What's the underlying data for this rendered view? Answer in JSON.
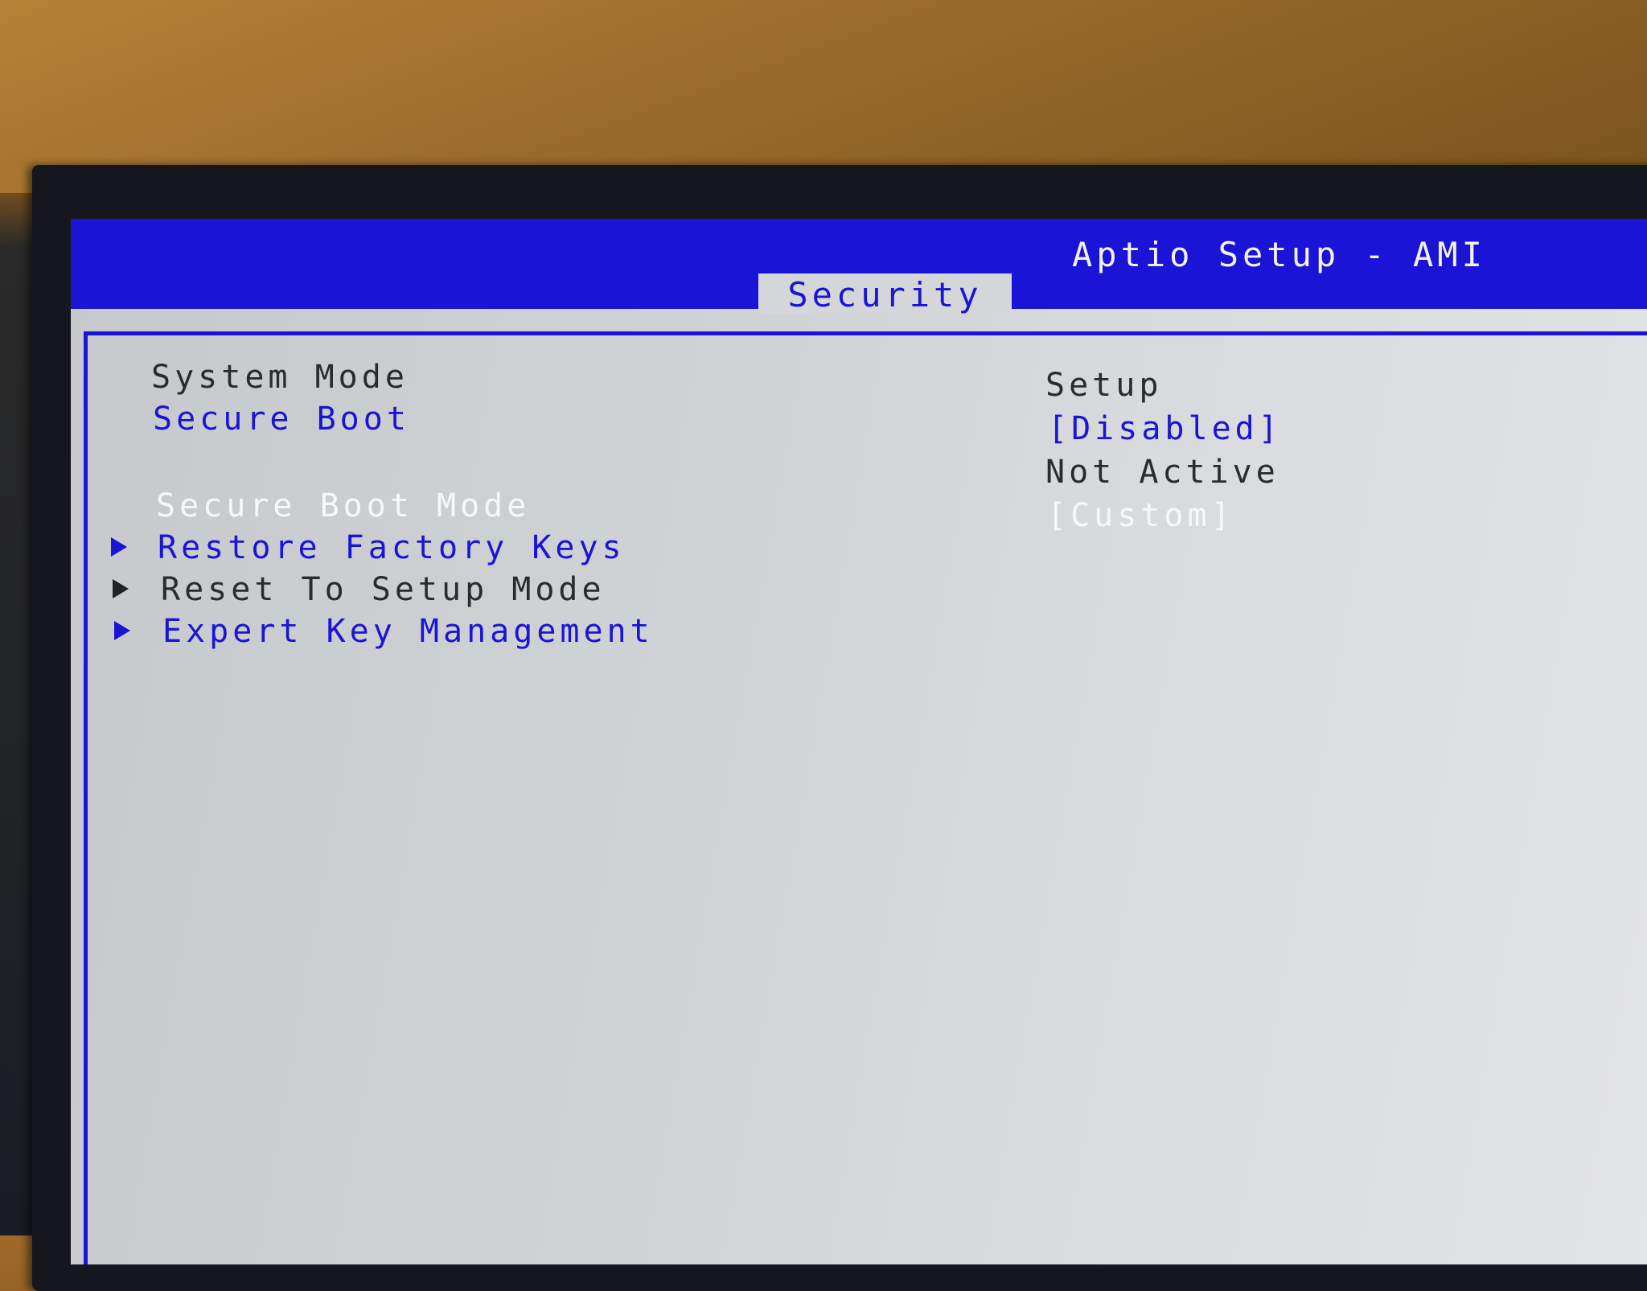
{
  "window": {
    "title": "Aptio Setup - AMI",
    "active_tab": "Security"
  },
  "colors": {
    "accent_blue": "#1a14d6",
    "panel_grey": "#d4d6d8",
    "text_dark": "#2b2b2b",
    "text_white": "#f7f7f7"
  },
  "settings": [
    {
      "label": "System Mode",
      "value": "Setup",
      "label_style": "plain",
      "value_style": "plain"
    },
    {
      "label": "Secure Boot",
      "value": "[Disabled]",
      "label_style": "link",
      "value_style": "link"
    },
    {
      "label": "",
      "value": "Not Active",
      "label_style": "plain",
      "value_style": "plain"
    },
    {
      "label": "Secure Boot Mode",
      "value": "[Custom]",
      "label_style": "white",
      "value_style": "white"
    }
  ],
  "submenus": [
    {
      "label": "Restore Factory Keys",
      "style": "link",
      "icon": "right-triangle-icon"
    },
    {
      "label": "Reset To Setup Mode",
      "style": "plain",
      "icon": "right-triangle-icon"
    },
    {
      "label": "Expert Key Management",
      "style": "link",
      "icon": "right-triangle-icon"
    }
  ]
}
